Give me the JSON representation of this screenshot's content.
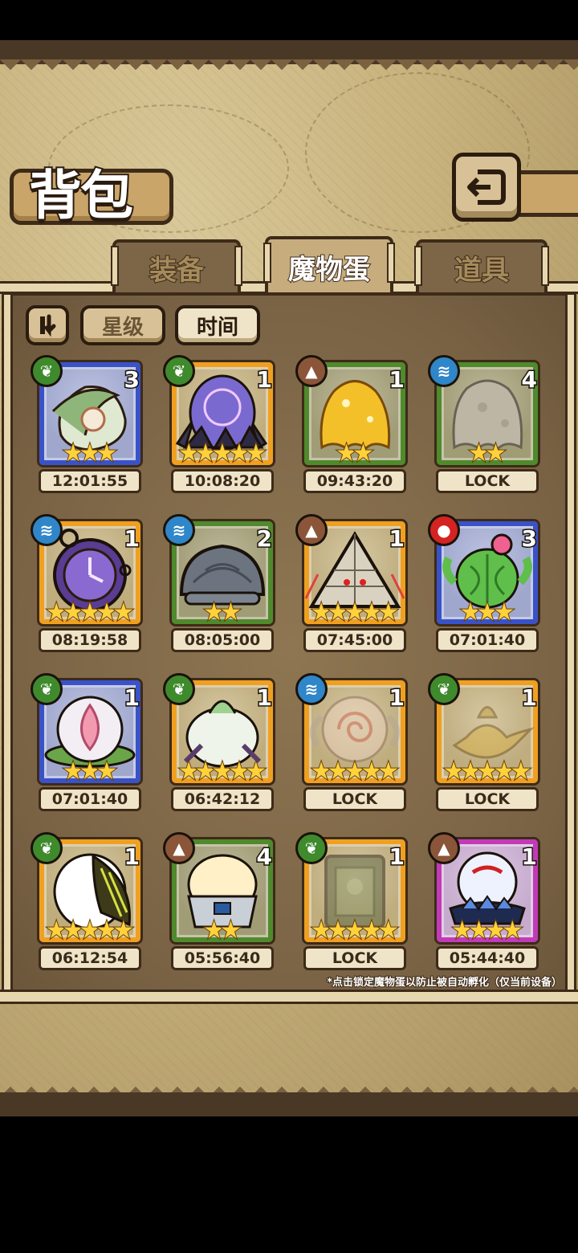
{
  "title": "背包",
  "icons": {
    "back": "back-arrow-icon",
    "sort_order": "sort-order-icon"
  },
  "tabs": [
    {
      "label": "装备",
      "active": false
    },
    {
      "label": "魔物蛋",
      "active": true
    },
    {
      "label": "道具",
      "active": false
    }
  ],
  "sort": {
    "star_label": "星级",
    "time_label": "时间",
    "selected": "时间"
  },
  "eggs": [
    {
      "element": "grass",
      "count": "3",
      "stars": 3,
      "rim": "#3a52c8",
      "timer": "12:01:55",
      "art": "leaf-cocoon"
    },
    {
      "element": "grass",
      "count": "1",
      "stars": 5,
      "rim": "#f0a020",
      "timer": "10:08:20",
      "art": "crystal-egg"
    },
    {
      "element": "earth",
      "count": "1",
      "stars": 2,
      "rim": "#4f8a2c",
      "timer": "09:43:20",
      "art": "gold-slime"
    },
    {
      "element": "water",
      "count": "4",
      "stars": 2,
      "rim": "#4f8a2c",
      "timer": "LOCK",
      "art": "grey-slime"
    },
    {
      "element": "water",
      "count": "1",
      "stars": 5,
      "rim": "#f0a020",
      "timer": "08:19:58",
      "art": "pocket-watch"
    },
    {
      "element": "water",
      "count": "2",
      "stars": 2,
      "rim": "#4f8a2c",
      "timer": "08:05:00",
      "art": "shell"
    },
    {
      "element": "earth",
      "count": "1",
      "stars": 5,
      "rim": "#f0a020",
      "timer": "07:45:00",
      "art": "pyramid"
    },
    {
      "element": "fire",
      "count": "3",
      "stars": 3,
      "rim": "#3a52c8",
      "timer": "07:01:40",
      "art": "cactus"
    },
    {
      "element": "grass",
      "count": "1",
      "stars": 3,
      "rim": "#3a52c8",
      "timer": "07:01:40",
      "art": "lotus-bud"
    },
    {
      "element": "grass",
      "count": "1",
      "stars": 5,
      "rim": "#f0a020",
      "timer": "06:42:12",
      "art": "sprout-egg"
    },
    {
      "element": "water",
      "count": "1",
      "stars": 5,
      "rim": "#f0a020",
      "timer": "LOCK",
      "art": "swirl-egg"
    },
    {
      "element": "grass",
      "count": "1",
      "stars": 5,
      "rim": "#f0a020",
      "timer": "LOCK",
      "art": "magic-lamp"
    },
    {
      "element": "grass",
      "count": "1",
      "stars": 5,
      "rim": "#f0a020",
      "timer": "06:12:54",
      "art": "wing-egg"
    },
    {
      "element": "earth",
      "count": "4",
      "stars": 2,
      "rim": "#4f8a2c",
      "timer": "05:56:40",
      "art": "cream-egg"
    },
    {
      "element": "grass",
      "count": "1",
      "stars": 5,
      "rim": "#f0a020",
      "timer": "LOCK",
      "art": "slate"
    },
    {
      "element": "earth",
      "count": "1",
      "stars": 4,
      "rim": "#c23ab8",
      "timer": "05:44:40",
      "art": "orb-egg"
    }
  ],
  "footnote": "*点击锁定魔物蛋以防止被自动孵化（仅当前设备）"
}
